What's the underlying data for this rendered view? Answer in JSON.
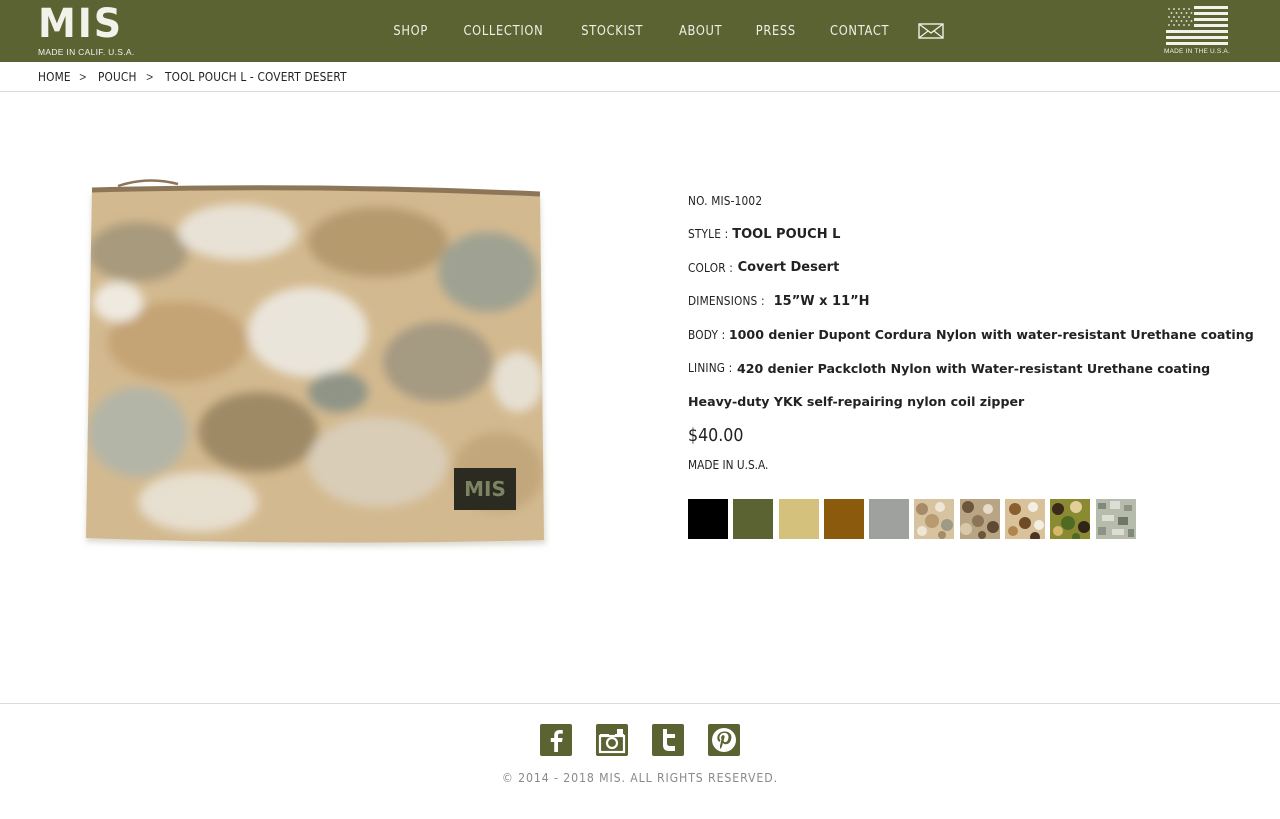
{
  "header": {
    "logo": {
      "mark": "MIS",
      "subtitle": "MADE IN CALIF. U.S.A."
    },
    "nav": [
      "SHOP",
      "COLLECTION",
      "STOCKIST",
      "ABOUT",
      "PRESS",
      "CONTACT"
    ],
    "flag_caption": "MADE IN THE U.S.A.",
    "colors": {
      "header_bg": "#5b6333"
    }
  },
  "breadcrumb": [
    "HOME",
    "POUCH",
    "TOOL POUCH L - COVERT DESERT"
  ],
  "breadcrumb_separator": ">",
  "product": {
    "number": "NO. MIS-1002",
    "style_label": "STYLE :",
    "style_value": "TOOL POUCH L",
    "color_label": "COLOR :",
    "color_value": "Covert Desert",
    "dimensions_label": "DIMENSIONS :",
    "dimensions_value": "15”W x 11”H",
    "body_label": "BODY :",
    "body_value": "1000 denier Dupont Cordura Nylon with water-resistant Urethane coating",
    "lining_label": "LINING :",
    "lining_value": "420 denier Packcloth Nylon with Water-resistant Urethane coating",
    "zipper": "Heavy-duty YKK self-repairing nylon coil zipper",
    "price": "$40.00",
    "made_in": "MADE IN U.S.A.",
    "patch_text": "MIS",
    "swatches": [
      {
        "name": "black",
        "color": "#000000"
      },
      {
        "name": "olive",
        "color": "#5b6333"
      },
      {
        "name": "tan",
        "color": "#d4c27c"
      },
      {
        "name": "coyote",
        "color": "#8b5a0c"
      },
      {
        "name": "gray",
        "color": "#9ea19e"
      },
      {
        "name": "desert-camo",
        "color": "#c9a982"
      },
      {
        "name": "woodland-desert-camo",
        "color": "#8c7a5c"
      },
      {
        "name": "tri-color-camo",
        "color": "#b08d5b"
      },
      {
        "name": "woodland-camo",
        "color": "#6b6b2a"
      },
      {
        "name": "digital-camo",
        "color": "#a3a99a"
      }
    ]
  },
  "footer": {
    "social": [
      "facebook-icon",
      "instagram-icon",
      "twitter-icon",
      "pinterest-icon"
    ],
    "copyright": "© 2014 - 2018 MIS. ALL RIGHTS RESERVED.",
    "icon_color": "#5b6333"
  }
}
